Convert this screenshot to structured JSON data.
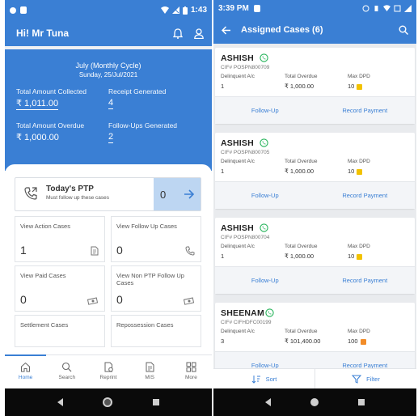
{
  "left": {
    "status_time": "1:43",
    "greeting": "Hi! Mr Tuna",
    "cycle": "July (Monthly Cycle)",
    "date": "Sunday, 25/Jul/2021",
    "stats": {
      "collected_label": "Total Amount Collected",
      "collected_value": "₹ 1,011.00",
      "receipt_label": "Receipt Generated",
      "receipt_value": "4",
      "overdue_label": "Total Amount Overdue",
      "overdue_value": "₹ 1,000.00",
      "followups_label": "Follow-Ups Generated",
      "followups_value": "2"
    },
    "ptp": {
      "title": "Today's PTP",
      "subtitle": "Must follow up these cases",
      "count": "0"
    },
    "tiles": [
      {
        "label": "View Action Cases",
        "value": "1"
      },
      {
        "label": "View Follow Up Cases",
        "value": "0"
      },
      {
        "label": "View Paid Cases",
        "value": "0"
      },
      {
        "label": "View Non PTP Follow Up Cases",
        "value": "0"
      },
      {
        "label": "Settlement Cases",
        "value": ""
      },
      {
        "label": "Repossession Cases",
        "value": ""
      }
    ],
    "nav": [
      {
        "label": "Home"
      },
      {
        "label": "Search"
      },
      {
        "label": "Reprint"
      },
      {
        "label": "MIS"
      },
      {
        "label": "More"
      }
    ]
  },
  "right": {
    "status_time": "3:39 PM",
    "title": "Assigned Cases (6)",
    "col_labels": {
      "delinquent": "Delinquent A/c",
      "overdue": "Total Overdue",
      "dpd": "Max DPD"
    },
    "actions": {
      "follow_up": "Follow-Up",
      "record_payment": "Record Payment"
    },
    "cases": [
      {
        "name": "ASHISH",
        "cif": "CIF# POSPN800709",
        "delinquent": "1",
        "overdue": "₹ 1,000.00",
        "dpd": "10",
        "dpd_color": "#f2c200"
      },
      {
        "name": "ASHISH",
        "cif": "CIF# POSPN800705",
        "delinquent": "1",
        "overdue": "₹ 1,000.00",
        "dpd": "10",
        "dpd_color": "#f2c200"
      },
      {
        "name": "ASHISH",
        "cif": "CIF# POSPN800704",
        "delinquent": "1",
        "overdue": "₹ 1,000.00",
        "dpd": "10",
        "dpd_color": "#f2c200"
      },
      {
        "name": "SHEENAM",
        "cif": "CIF# CIFHDFC00199",
        "delinquent": "3",
        "overdue": "₹ 101,400.00",
        "dpd": "100",
        "dpd_color": "#f28c28"
      }
    ],
    "sort_label": "Sort",
    "filter_label": "Filter"
  },
  "colors": {
    "primary": "#3a7fd4",
    "whatsapp": "#25b35a",
    "ptp_count_bg": "#bdd6f2"
  }
}
